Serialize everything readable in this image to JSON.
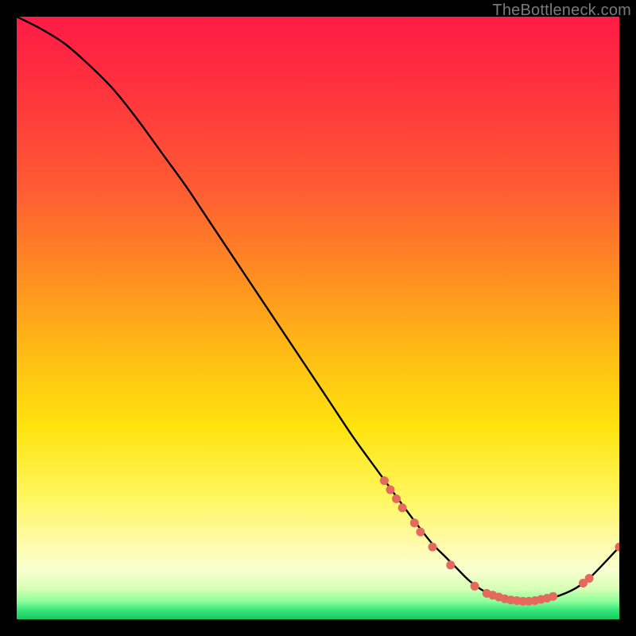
{
  "watermark": "TheBottleneck.com",
  "colors": {
    "background": "#000000",
    "gradient_top": "#ff1b46",
    "gradient_mid": "#ffe30e",
    "gradient_bottom": "#17c95e",
    "line": "#000000",
    "marker": "#e46a5e"
  },
  "chart_data": {
    "type": "line",
    "title": "",
    "xlabel": "",
    "ylabel": "",
    "xlim": [
      0,
      100
    ],
    "ylim": [
      0,
      100
    ],
    "x": [
      0,
      4,
      8,
      12,
      16,
      20,
      24,
      28,
      32,
      36,
      40,
      44,
      48,
      52,
      56,
      60,
      64,
      67,
      69,
      71,
      73,
      75,
      77,
      79,
      81,
      83,
      85,
      87,
      89,
      91,
      93,
      95,
      97,
      100
    ],
    "y": [
      100,
      98,
      95.5,
      92,
      88,
      83,
      77.5,
      72,
      66,
      60,
      54,
      48,
      42,
      36,
      30,
      24.5,
      19,
      15,
      12.5,
      10.5,
      8.5,
      6.5,
      5,
      4,
      3.3,
      3,
      3,
      3.2,
      3.6,
      4.3,
      5.3,
      6.8,
      8.8,
      12
    ],
    "markers": [
      {
        "x": 61,
        "y": 23
      },
      {
        "x": 62,
        "y": 21.5
      },
      {
        "x": 63,
        "y": 20
      },
      {
        "x": 64,
        "y": 18.5
      },
      {
        "x": 66,
        "y": 16
      },
      {
        "x": 67,
        "y": 14.5
      },
      {
        "x": 69,
        "y": 12
      },
      {
        "x": 72,
        "y": 9
      },
      {
        "x": 76,
        "y": 5.5
      },
      {
        "x": 78,
        "y": 4.3
      },
      {
        "x": 79,
        "y": 4
      },
      {
        "x": 80,
        "y": 3.7
      },
      {
        "x": 81,
        "y": 3.4
      },
      {
        "x": 82,
        "y": 3.2
      },
      {
        "x": 83,
        "y": 3.1
      },
      {
        "x": 84,
        "y": 3.0
      },
      {
        "x": 85,
        "y": 3.0
      },
      {
        "x": 86,
        "y": 3.1
      },
      {
        "x": 87,
        "y": 3.3
      },
      {
        "x": 88,
        "y": 3.5
      },
      {
        "x": 89,
        "y": 3.8
      },
      {
        "x": 94,
        "y": 6
      },
      {
        "x": 95,
        "y": 6.8
      },
      {
        "x": 100,
        "y": 12
      }
    ]
  }
}
